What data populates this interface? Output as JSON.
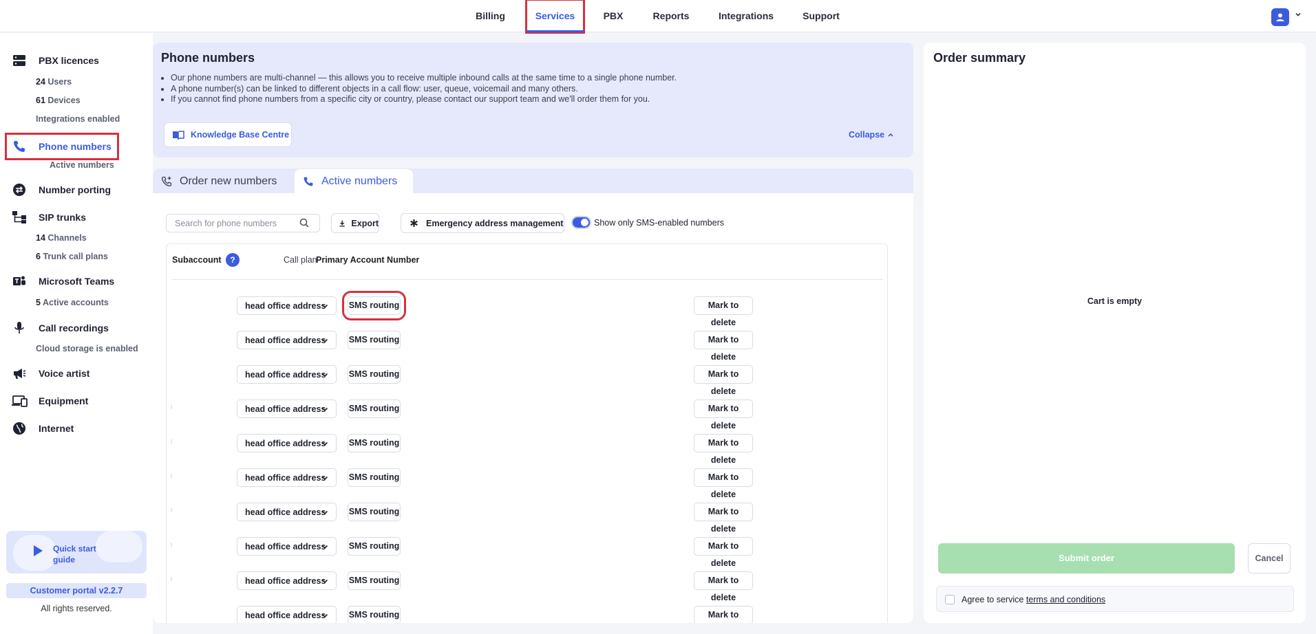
{
  "nav": {
    "items": [
      "Billing",
      "Services",
      "PBX",
      "Reports",
      "Integrations",
      "Support"
    ],
    "active": "Services"
  },
  "sidebar": {
    "pbx": {
      "label": "PBX licences",
      "users_count": "24",
      "users_label": "Users",
      "devices_count": "61",
      "devices_label": "Devices",
      "integrations": "Integrations enabled"
    },
    "phone": {
      "label": "Phone numbers",
      "sub": "Active numbers"
    },
    "porting": {
      "label": "Number porting"
    },
    "sip": {
      "label": "SIP trunks",
      "channels_count": "14",
      "channels_label": "Channels",
      "plans_count": "6",
      "plans_label": "Trunk call plans"
    },
    "teams": {
      "label": "Microsoft Teams",
      "accounts_count": "5",
      "accounts_label": "Active accounts"
    },
    "recordings": {
      "label": "Call recordings",
      "sub": "Cloud storage is enabled"
    },
    "voice": {
      "label": "Voice artist"
    },
    "equipment": {
      "label": "Equipment"
    },
    "internet": {
      "label": "Internet"
    },
    "quick_start": "Quick start guide",
    "version": "Customer portal v2.2.7",
    "rights": "All rights reserved."
  },
  "info": {
    "title": "Phone numbers",
    "bullets": [
      "Our phone numbers are multi-channel — this allows you to receive multiple inbound calls at the same time to a single phone number.",
      "A phone number(s) can be linked to different objects in a call flow: user, queue, voicemail and many others.",
      "If you cannot find phone numbers from a specific city or country, please contact our support team and we'll order them for you."
    ],
    "kb_button": "Knowledge Base Centre",
    "collapse": "Collapse"
  },
  "tabs": {
    "order": "Order new numbers",
    "active": "Active numbers"
  },
  "toolbar": {
    "search_placeholder": "Search for phone numbers",
    "export": "Export",
    "emergency": "Emergency address management",
    "sms_toggle_label": "Show only SMS-enabled numbers",
    "sms_toggle_on": true
  },
  "table": {
    "headers": {
      "subaccount": "Subaccount",
      "help": "?",
      "call_plan": "Call plan",
      "pan": "Primary Account Number"
    },
    "rows": [
      {
        "address": "head office address",
        "sms": "SMS routing",
        "delete": "Mark to delete"
      },
      {
        "address": "head office address",
        "sms": "SMS routing",
        "delete": "Mark to delete"
      },
      {
        "address": "head office address",
        "sms": "SMS routing",
        "delete": "Mark to delete"
      },
      {
        "address": "head office address",
        "sms": "SMS routing",
        "delete": "Mark to delete"
      },
      {
        "address": "head office address",
        "sms": "SMS routing",
        "delete": "Mark to delete"
      },
      {
        "address": "head office address",
        "sms": "SMS routing",
        "delete": "Mark to delete"
      },
      {
        "address": "head office address",
        "sms": "SMS routing",
        "delete": "Mark to delete"
      },
      {
        "address": "head office address",
        "sms": "SMS routing",
        "delete": "Mark to delete"
      },
      {
        "address": "head office address",
        "sms": "SMS routing",
        "delete": "Mark to delete"
      },
      {
        "address": "head office address",
        "sms": "SMS routing",
        "delete": "Mark to delete"
      }
    ]
  },
  "order": {
    "title": "Order summary",
    "cart_empty": "Cart is empty",
    "submit": "Submit order",
    "cancel": "Cancel",
    "agree_prefix": "Agree to service",
    "terms": "terms and conditions"
  },
  "colors": {
    "accent": "#3b5be0",
    "highlight": "#d63040",
    "submit_disabled": "#a7dfb0",
    "info_bg": "#e6e9fb"
  }
}
